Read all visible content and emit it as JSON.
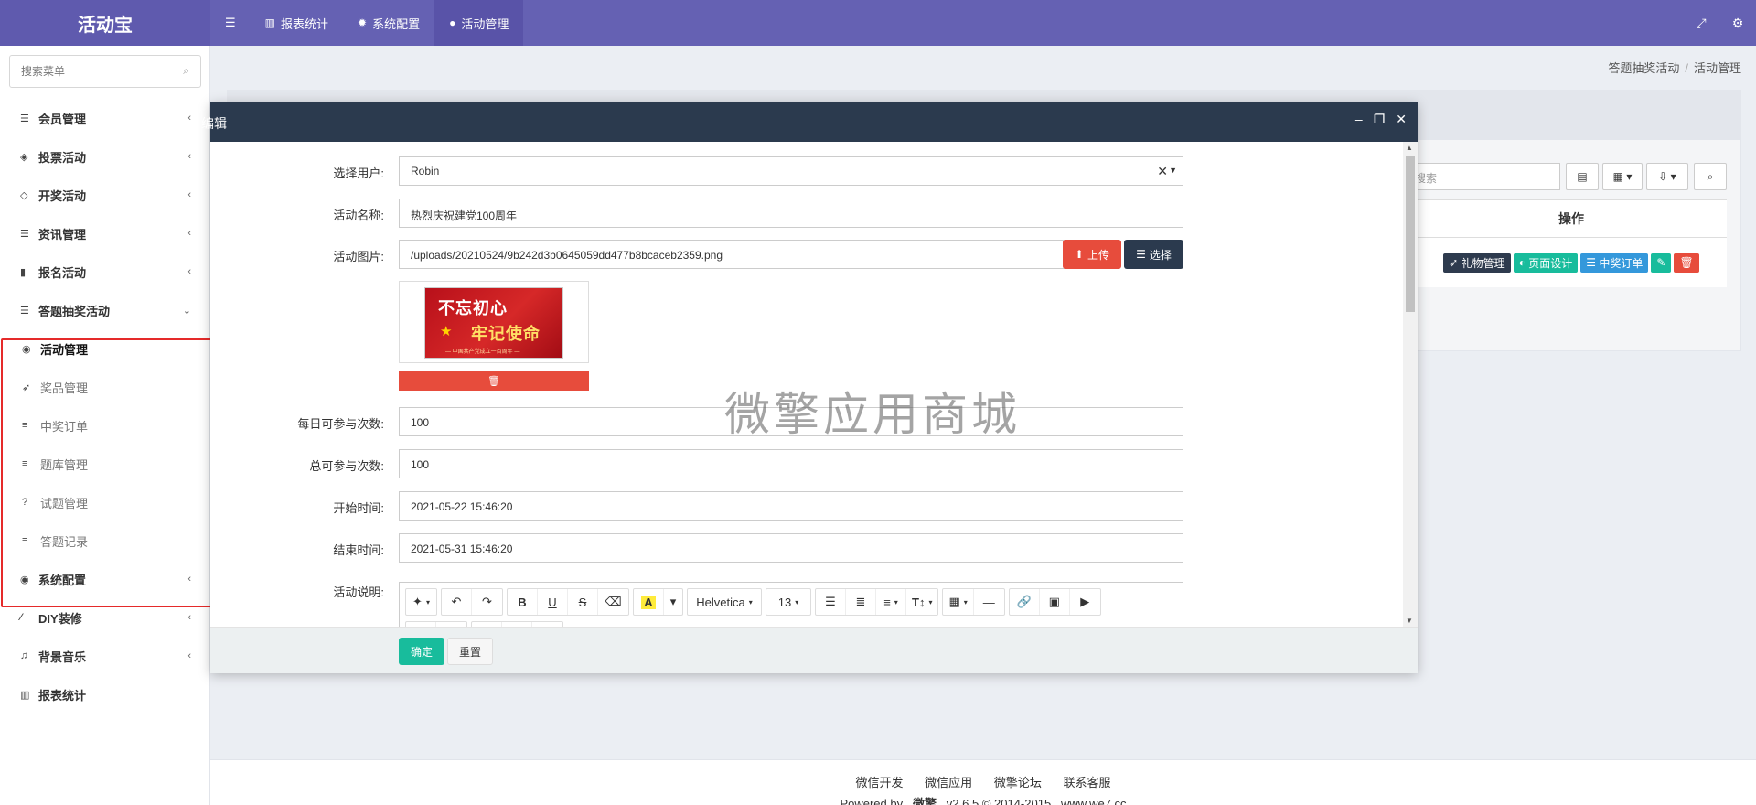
{
  "app": {
    "brand": "活动宝"
  },
  "topnav": {
    "items": [
      {
        "label": "报表统计",
        "icon": "bar-chart-icon"
      },
      {
        "label": "系统配置",
        "icon": "gear-icon"
      },
      {
        "label": "活动管理",
        "icon": "circle-icon"
      }
    ]
  },
  "sidebar": {
    "search_placeholder": "搜索菜单",
    "items": [
      {
        "label": "会员管理"
      },
      {
        "label": "投票活动"
      },
      {
        "label": "开奖活动"
      },
      {
        "label": "资讯管理"
      },
      {
        "label": "报名活动"
      },
      {
        "label": "答题抽奖活动"
      },
      {
        "label": "系统配置"
      },
      {
        "label": "DIY装修"
      },
      {
        "label": "背景音乐"
      },
      {
        "label": "报表统计"
      }
    ],
    "submenu": [
      {
        "label": "活动管理"
      },
      {
        "label": "奖品管理"
      },
      {
        "label": "中奖订单"
      },
      {
        "label": "题库管理"
      },
      {
        "label": "试题管理"
      },
      {
        "label": "答题记录"
      }
    ]
  },
  "breadcrumb": {
    "parent": "答题抽奖活动",
    "current": "活动管理"
  },
  "background": {
    "search_placeholder": "搜索",
    "table_header": "操作",
    "row_actions": [
      "礼物管理",
      "页面设计",
      "中奖订单"
    ]
  },
  "modal": {
    "title": "编辑",
    "fields": {
      "user": {
        "label": "选择用户:",
        "value": "Robin"
      },
      "name": {
        "label": "活动名称:",
        "value": "热烈庆祝建党100周年"
      },
      "image": {
        "label": "活动图片:",
        "value": "/uploads/20210524/9b242d3b0645059dd477b8bcaceb2359.png",
        "upload": "上传",
        "choose": "选择"
      },
      "daily": {
        "label": "每日可参与次数:",
        "value": "100"
      },
      "total": {
        "label": "总可参与次数:",
        "value": "100"
      },
      "start": {
        "label": "开始时间:",
        "value": "2021-05-22 15:46:20"
      },
      "end": {
        "label": "结束时间:",
        "value": "2021-05-31 15:46:20"
      },
      "desc": {
        "label": "活动说明:"
      }
    },
    "banner": {
      "line1": "不忘初心",
      "line2": "牢记使命",
      "sub": "— 中国共产党成立一百周年 —"
    },
    "editor": {
      "font": "Helvetica",
      "size": "13"
    },
    "confirm": "确定",
    "reset": "重置"
  },
  "watermark": "微擎应用商城",
  "footer": {
    "links": [
      "微信开发",
      "微信应用",
      "微擎论坛",
      "联系客服"
    ],
    "powered": "Powered by",
    "brand": "微擎",
    "version": "v2.6.5 © 2014-2015",
    "site": "www.we7.cc"
  }
}
